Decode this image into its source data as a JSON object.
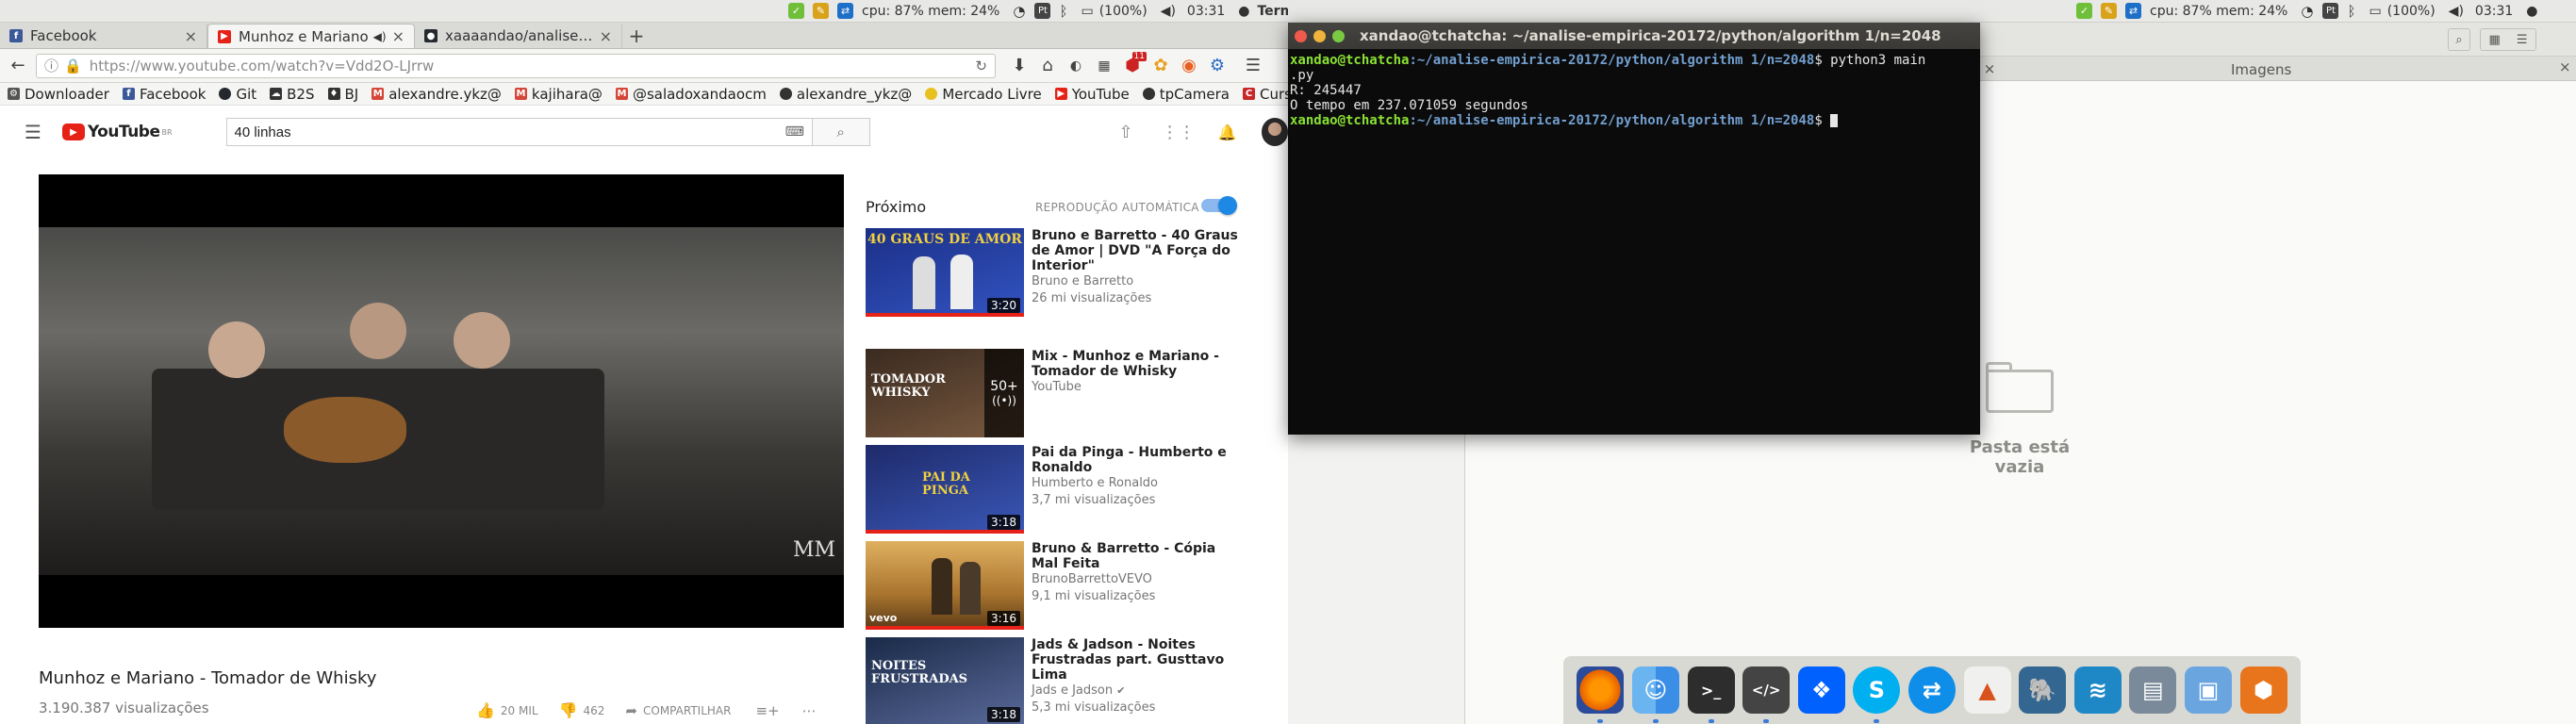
{
  "left_panel": {
    "status_text": "cpu: 87% mem: 24%",
    "battery": "(100%)",
    "clock": "03:31",
    "app_name": "Terminal",
    "pt_badge": "Pt"
  },
  "right_panel": {
    "status_text": "cpu: 87% mem: 24%",
    "battery": "(100%)",
    "clock": "03:31",
    "pt_badge": "Pt"
  },
  "browser": {
    "tabs": [
      {
        "label": "Facebook",
        "favicon_color": "#3b5998",
        "favicon_glyph": "f"
      },
      {
        "label": "Munhoz e Mariano",
        "favicon_color": "#e62117",
        "favicon_glyph": "▶",
        "audio": "◀)"
      },
      {
        "label": "xaaaandao/analise-em",
        "favicon_color": "#24292e",
        "favicon_glyph": "●"
      }
    ],
    "url": "https://www.youtube.com/watch?v=Vdd2O-LJrrw",
    "badge_count": "11",
    "bookmarks": [
      {
        "label": "Downloader",
        "color": "#555",
        "glyph": "⚙"
      },
      {
        "label": "Facebook",
        "color": "#3b5998",
        "glyph": "f"
      },
      {
        "label": "Git",
        "color": "#24292e",
        "glyph": "●"
      },
      {
        "label": "B2S",
        "color": "#333",
        "glyph": "☁"
      },
      {
        "label": "BJ",
        "color": "#333",
        "glyph": "♦"
      },
      {
        "label": "alexandre.ykz@",
        "color": "#d44638",
        "glyph": "M"
      },
      {
        "label": "kajihara@",
        "color": "#d44638",
        "glyph": "M"
      },
      {
        "label": "@saladoxandaocm",
        "color": "#d44638",
        "glyph": "M"
      },
      {
        "label": "alexandre_ykz@",
        "color": "#333",
        "glyph": "●"
      },
      {
        "label": "Mercado Livre",
        "color": "#e8c020",
        "glyph": "◎"
      },
      {
        "label": "YouTube",
        "color": "#e62117",
        "glyph": "▶"
      },
      {
        "label": "tpCamera",
        "color": "#333",
        "glyph": "◯"
      },
      {
        "label": "Cursinho",
        "color": "#c62828",
        "glyph": "C"
      }
    ]
  },
  "youtube": {
    "logo_text": "YouTube",
    "logo_region": "BR",
    "search_value": "40 linhas",
    "video_title": "Munhoz e Mariano - Tomador de Whisky",
    "views": "3.190.387 visualizações",
    "likes": "20 MIL",
    "dislikes": "462",
    "share_label": "COMPARTILHAR",
    "watermark": "MM",
    "up_next_label": "Próximo",
    "autoplay_label": "REPRODUÇÃO AUTOMÁTICA",
    "autoplay_on": true,
    "recommendations": [
      {
        "title": "Bruno e Barretto - 40 Graus de Amor | DVD \"A Força do Interior\"",
        "channel": "Bruno e Barretto",
        "views": "26 mi visualizações",
        "duration": "3:20",
        "thumb_text": "40 GRAUS DE AMOR",
        "colors": [
          "#1b2f86",
          "#3354c2"
        ]
      },
      {
        "title": "Mix - Munhoz e Mariano - Tomador de Whisky",
        "channel": "YouTube",
        "views": "",
        "duration": "",
        "thumb_text": "TOMADOR WHISKY",
        "playlist_count": "50+",
        "colors": [
          "#3a2a20",
          "#7a5a40"
        ]
      },
      {
        "title": "Pai da Pinga - Humberto e Ronaldo",
        "channel": "Humberto e Ronaldo",
        "views": "3,7 mi visualizações",
        "duration": "3:18",
        "thumb_text": "PAI DA PINGA",
        "colors": [
          "#1e2a6a",
          "#3a58b8"
        ]
      },
      {
        "title": "Bruno & Barretto - Cópia Mal Feita",
        "channel": "BrunoBarrettoVEVO",
        "views": "9,1 mi visualizações",
        "duration": "3:16",
        "thumb_text": "vevo",
        "colors": [
          "#a8742e",
          "#e0b060"
        ]
      },
      {
        "title": "Jads & Jadson - Noites Frustradas part. Gusttavo Lima",
        "channel": "Jads e Jadson",
        "views": "5,3 mi visualizações",
        "duration": "3:18",
        "thumb_text": "NOITES FRUSTRADAS",
        "colors": [
          "#1a2a48",
          "#5a6a9a"
        ]
      }
    ]
  },
  "terminal": {
    "title": "xandao@tchatcha: ~/analise-empirica-20172/python/algorithm 1/n=2048",
    "prompt_user": "xandao@tchatcha",
    "prompt_path": ":~/analise-empirica-20172/python/algorithm 1/n=2048",
    "prompt_symbol": "$",
    "command": " python3 main",
    "command_cont": ".py",
    "output_1": "R: 245447",
    "output_2": "O tempo em 237.071059 segundos"
  },
  "file_manager": {
    "tab_label": "Imagens",
    "empty_text": "Pasta está vazia"
  },
  "dock": [
    {
      "name": "firefox-icon",
      "color": "#e66000",
      "glyph": "◉"
    },
    {
      "name": "finder-icon",
      "color": "#3a8ee6",
      "glyph": "☺"
    },
    {
      "name": "terminal-icon",
      "color": "#2d2d2d",
      "glyph": ">_"
    },
    {
      "name": "code-editor-icon",
      "color": "#444444",
      "glyph": "</>"
    },
    {
      "name": "dropbox-icon",
      "color": "#0061fe",
      "glyph": "❖"
    },
    {
      "name": "skype-icon",
      "color": "#00aff0",
      "glyph": "S"
    },
    {
      "name": "teamviewer-icon",
      "color": "#0e8ee9",
      "glyph": "⇄"
    },
    {
      "name": "matlab-icon",
      "color": "#d9531e",
      "glyph": "▲"
    },
    {
      "name": "postgres-icon",
      "color": "#336791",
      "glyph": "🐘"
    },
    {
      "name": "mysql-workbench-icon",
      "color": "#1e88c7",
      "glyph": "≋"
    },
    {
      "name": "disk-utility-icon",
      "color": "#7a8a9a",
      "glyph": "▤"
    },
    {
      "name": "virtualbox-icon",
      "color": "#6aa5e0",
      "glyph": "▣"
    },
    {
      "name": "package-manager-icon",
      "color": "#e8741c",
      "glyph": "⬢"
    }
  ]
}
